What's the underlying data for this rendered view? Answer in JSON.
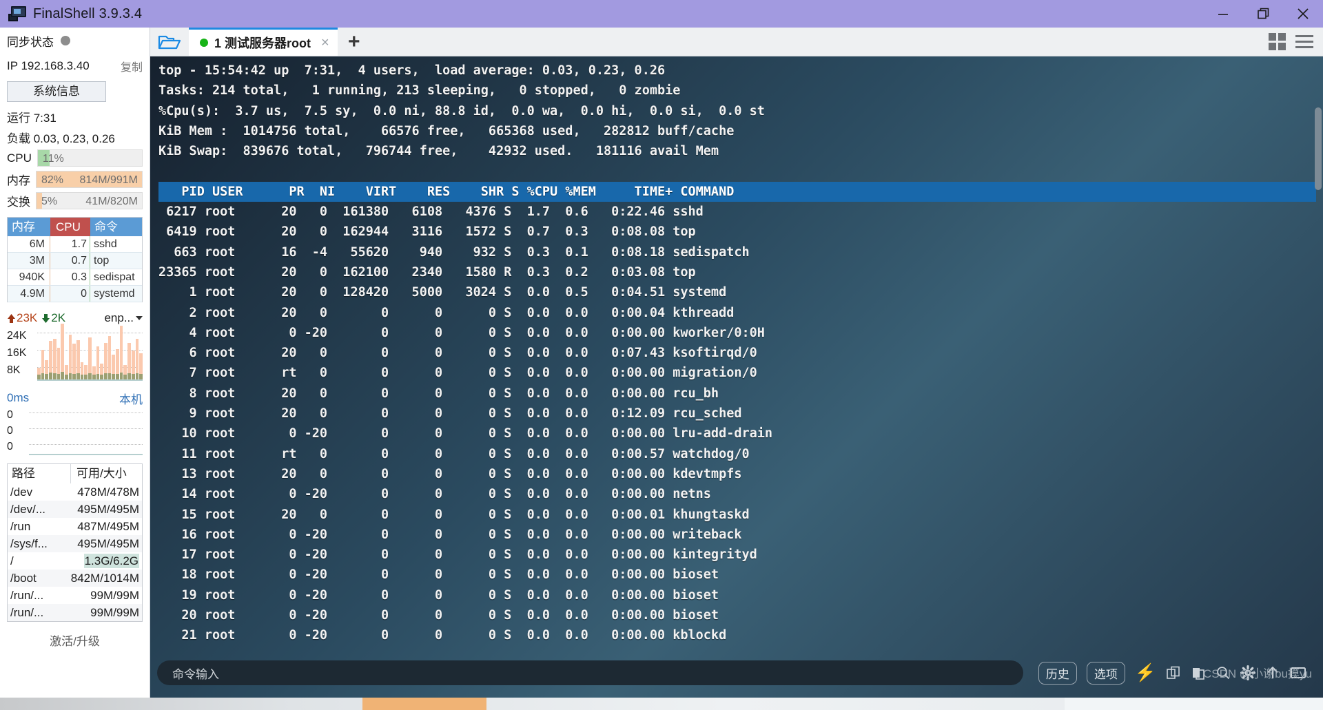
{
  "titlebar": {
    "app_name": "FinalShell 3.9.3.4",
    "icon": "monitor-icon",
    "minimize": "minimize-icon",
    "maximize": "restore-icon",
    "close": "close-icon"
  },
  "sidebar": {
    "sync_label": "同步状态",
    "ip_label": "IP 192.168.3.40",
    "copy_label": "复制",
    "sysinfo_button": "系统信息",
    "uptime": "运行 7:31",
    "load": "负载 0.03, 0.23, 0.26",
    "meters": [
      {
        "label": "CPU",
        "pct_text": "11%",
        "amount": "",
        "pct": 11,
        "color": "#a8d8a8"
      },
      {
        "label": "内存",
        "pct_text": "82%",
        "amount": "814M/991M",
        "pct": 100,
        "color": "#f8cfa8"
      },
      {
        "label": "交换",
        "pct_text": "5%",
        "amount": "41M/820M",
        "pct": 5,
        "color": "#f8cfa8"
      }
    ],
    "proc_headers": {
      "mem": "内存",
      "cpu": "CPU",
      "cmd": "命令"
    },
    "proc_rows": [
      {
        "mem": "6M",
        "cpu": "1.7",
        "cmd": "sshd"
      },
      {
        "mem": "3M",
        "cpu": "0.7",
        "cmd": "top"
      },
      {
        "mem": "940K",
        "cpu": "0.3",
        "cmd": "sedispat"
      },
      {
        "mem": "4.9M",
        "cpu": "0",
        "cmd": "systemd"
      }
    ],
    "net": {
      "up": "23K",
      "down": "2K",
      "interface": "enp...",
      "y_labels": [
        "24K",
        "16K",
        "8K"
      ]
    },
    "latency": {
      "value": "0ms",
      "target": "本机",
      "y_labels": [
        "0",
        "0",
        "0"
      ]
    },
    "disk_headers": {
      "path": "路径",
      "size": "可用/大小"
    },
    "disks": [
      {
        "path": "/dev",
        "size": "478M/478M",
        "highlight": ""
      },
      {
        "path": "/dev/...",
        "size": "495M/495M",
        "highlight": ""
      },
      {
        "path": "/run",
        "size": "487M/495M",
        "highlight": ""
      },
      {
        "path": "/sys/f...",
        "size": "495M/495M",
        "highlight": ""
      },
      {
        "path": "/",
        "size": "",
        "highlight": "1.3G/6.2G"
      },
      {
        "path": "/boot",
        "size": "842M/1014M",
        "highlight": ""
      },
      {
        "path": "/run/...",
        "size": "99M/99M",
        "highlight": ""
      },
      {
        "path": "/run/...",
        "size": "99M/99M",
        "highlight": ""
      }
    ],
    "activate": "激活/升级"
  },
  "tabbar": {
    "folder_icon": "folder-open-icon",
    "tab_label": "1 测试服务器root",
    "tab_close": "×",
    "new_tab": "+",
    "grid_icon": "grid-view-icon",
    "menu_icon": "hamburger-menu-icon"
  },
  "terminal": {
    "lines": [
      "top - 15:54:42 up  7:31,  4 users,  load average: 0.03, 0.23, 0.26",
      "Tasks: 214 total,   1 running, 213 sleeping,   0 stopped,   0 zombie",
      "%Cpu(s):  3.7 us,  7.5 sy,  0.0 ni, 88.8 id,  0.0 wa,  0.0 hi,  0.0 si,  0.0 st",
      "KiB Mem :  1014756 total,    66576 free,   665368 used,   282812 buff/cache",
      "KiB Swap:  839676 total,   796744 free,    42932 used.   181116 avail Mem",
      ""
    ],
    "header_row": "   PID USER      PR  NI    VIRT    RES    SHR S %CPU %MEM     TIME+ COMMAND",
    "rows": [
      " 6217 root      20   0  161380   6108   4376 S  1.7  0.6   0:22.46 sshd",
      " 6419 root      20   0  162944   3116   1572 S  0.7  0.3   0:08.08 top",
      "  663 root      16  -4   55620    940    932 S  0.3  0.1   0:08.18 sedispatch",
      "23365 root      20   0  162100   2340   1580 R  0.3  0.2   0:03.08 top",
      "    1 root      20   0  128420   5000   3024 S  0.0  0.5   0:04.51 systemd",
      "    2 root      20   0       0      0      0 S  0.0  0.0   0:00.04 kthreadd",
      "    4 root       0 -20       0      0      0 S  0.0  0.0   0:00.00 kworker/0:0H",
      "    6 root      20   0       0      0      0 S  0.0  0.0   0:07.43 ksoftirqd/0",
      "    7 root      rt   0       0      0      0 S  0.0  0.0   0:00.00 migration/0",
      "    8 root      20   0       0      0      0 S  0.0  0.0   0:00.00 rcu_bh",
      "    9 root      20   0       0      0      0 S  0.0  0.0   0:12.09 rcu_sched",
      "   10 root       0 -20       0      0      0 S  0.0  0.0   0:00.00 lru-add-drain",
      "   11 root      rt   0       0      0      0 S  0.0  0.0   0:00.57 watchdog/0",
      "   13 root      20   0       0      0      0 S  0.0  0.0   0:00.00 kdevtmpfs",
      "   14 root       0 -20       0      0      0 S  0.0  0.0   0:00.00 netns",
      "   15 root      20   0       0      0      0 S  0.0  0.0   0:00.01 khungtaskd",
      "   16 root       0 -20       0      0      0 S  0.0  0.0   0:00.00 writeback",
      "   17 root       0 -20       0      0      0 S  0.0  0.0   0:00.00 kintegrityd",
      "   18 root       0 -20       0      0      0 S  0.0  0.0   0:00.00 bioset",
      "   19 root       0 -20       0      0      0 S  0.0  0.0   0:00.00 bioset",
      "   20 root       0 -20       0      0      0 S  0.0  0.0   0:00.00 bioset",
      "   21 root       0 -20       0      0      0 S  0.0  0.0   0:00.00 kblockd"
    ]
  },
  "command_bar": {
    "placeholder": "命令输入",
    "value": "",
    "history_button": "历史",
    "options_button": "选项",
    "icons": [
      "bolt-icon",
      "copy-files-icon",
      "paste-file-icon",
      "search-icon",
      "gear-icon",
      "upload-icon",
      "window-icon"
    ]
  },
  "watermark": "CSDN @小谢bu摸yu"
}
